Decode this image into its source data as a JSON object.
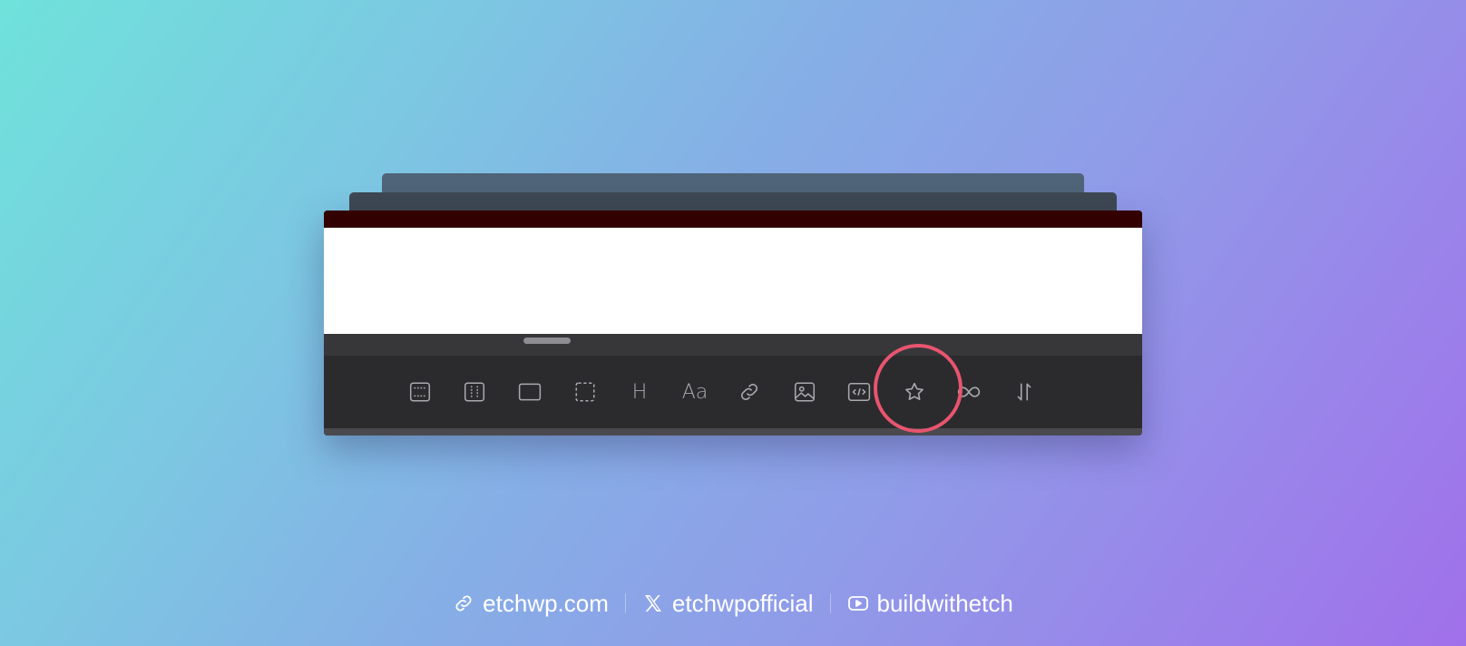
{
  "toolbar": {
    "items": [
      {
        "name": "section-block",
        "icon": "section-dashed-rows-icon"
      },
      {
        "name": "columns-block",
        "icon": "columns-dashed-icon"
      },
      {
        "name": "container-block",
        "icon": "container-rect-icon"
      },
      {
        "name": "div-block",
        "icon": "div-dashed-square-icon"
      },
      {
        "name": "heading-block",
        "icon": "heading-icon",
        "text": "H"
      },
      {
        "name": "text-block",
        "icon": "text-icon",
        "text": "Aa"
      },
      {
        "name": "link-block",
        "icon": "link-icon"
      },
      {
        "name": "image-block",
        "icon": "image-icon"
      },
      {
        "name": "code-block",
        "icon": "code-icon"
      },
      {
        "name": "component-block",
        "icon": "star-icon"
      },
      {
        "name": "loop-block",
        "icon": "infinity-icon"
      },
      {
        "name": "sort-block",
        "icon": "sort-icon"
      }
    ],
    "highlighted": "component-block",
    "highlight_color": "#e8546f"
  },
  "colors": {
    "topbar": "#330000",
    "toolbar": "#2b2b2e",
    "icon": "#a9a9ae"
  },
  "footer": {
    "website": "etchwp.com",
    "x_handle": "etchwpofficial",
    "youtube": "buildwithetch"
  }
}
